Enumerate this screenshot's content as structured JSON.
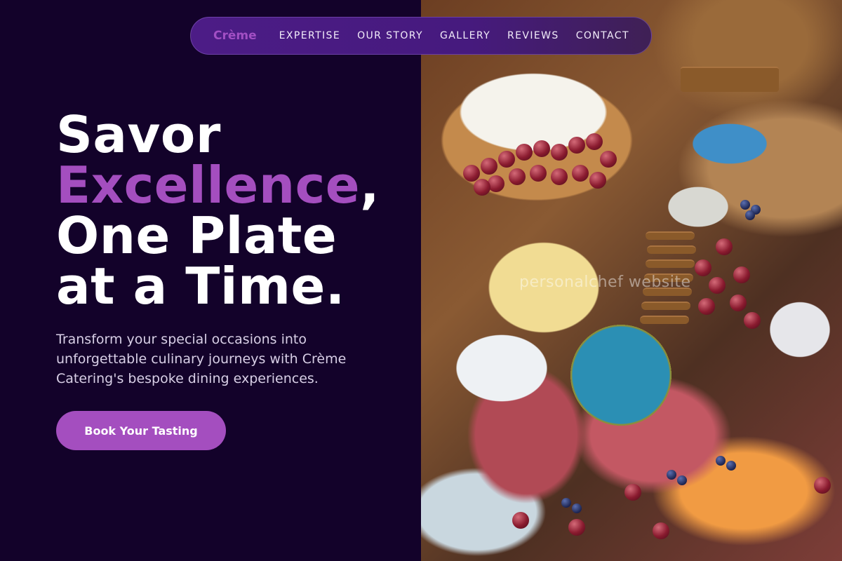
{
  "nav": {
    "brand": "Crème",
    "links": [
      "EXPERTISE",
      "OUR STORY",
      "GALLERY",
      "REVIEWS",
      "CONTACT"
    ]
  },
  "hero": {
    "line1": "Savor",
    "line2_accent": "Excellence",
    "line2_rest": ",",
    "line3": "One Plate",
    "line4": "at a Time.",
    "subtitle": "Transform your special occasions into unforgettable culinary journeys with Crème Catering's bespoke dining experiences.",
    "cta_label": "Book Your Tasting"
  },
  "image": {
    "description_icon": "charcuterie-board-photo",
    "watermark": "personalchef website"
  },
  "colors": {
    "background": "#13022a",
    "accent": "#a44ebf",
    "nav_bg": "#4c1c86"
  }
}
